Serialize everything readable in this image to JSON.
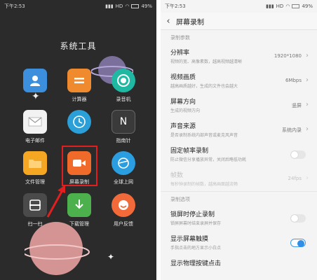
{
  "left": {
    "status": {
      "time": "下午2:53",
      "hd": "HD",
      "battery": "49%"
    },
    "folder_title": "系统工具",
    "apps": [
      {
        "label": "",
        "icon": "contacts-icon",
        "color": "#3b8fdc"
      },
      {
        "label": "计算器",
        "icon": "calculator-icon",
        "color": "#f08a2f"
      },
      {
        "label": "录音机",
        "icon": "recorder-icon",
        "color": "#1fb8a2"
      },
      {
        "label": "电子邮件",
        "icon": "mail-icon",
        "color": "#f2f2f2"
      },
      {
        "label": "",
        "icon": "clock-icon",
        "color": "#2b9fd8"
      },
      {
        "label": "指南针",
        "icon": "compass-icon",
        "color": "#3a3a3a"
      },
      {
        "label": "文件管理",
        "icon": "folder-icon",
        "color": "#f5a623"
      },
      {
        "label": "屏幕录制",
        "icon": "screen-record-icon",
        "color": "#f06a2a"
      },
      {
        "label": "全球上网",
        "icon": "globe-plane-icon",
        "color": "#2a9ee0"
      },
      {
        "label": "扫一扫",
        "icon": "scan-icon",
        "color": "#4a4a4a"
      },
      {
        "label": "下载管理",
        "icon": "download-icon",
        "color": "#4cb04c"
      },
      {
        "label": "用户反馈",
        "icon": "feedback-icon",
        "color": "#f26a3a"
      }
    ]
  },
  "right": {
    "status": {
      "time": "下午2:53",
      "hd": "HD",
      "battery": "49%"
    },
    "title": "屏幕录制",
    "section_params": "录制参数",
    "resolution": {
      "title": "分辨率",
      "desc": "视频的宽、高像素数，越高视频越清晰",
      "value": "1920*1080"
    },
    "quality": {
      "title": "视频画质",
      "desc": "越高画质越好，生成的文件也会越大",
      "value": "6Mbps"
    },
    "orientation": {
      "title": "屏幕方向",
      "desc": "生成的视频方向",
      "value": "竖屏"
    },
    "sound": {
      "title": "声音来源",
      "desc": "是否录制系统内部声音或麦克风声音",
      "value": "系统内录"
    },
    "fixed_fps": {
      "title": "固定帧率录制",
      "desc": "防止微信分享播放异常，关闭后略低功耗",
      "on": false
    },
    "fps": {
      "title": "帧数",
      "desc": "每秒钟录制的帧数，越高画面越流畅",
      "value": "24fps"
    },
    "section_options": "录制选项",
    "lock_stop": {
      "title": "锁屏时停止录制",
      "desc": "锁屏屏幕时结束录屏并保存",
      "on": false
    },
    "show_touch": {
      "title": "显示屏幕触摸",
      "desc": "手指点击的地方显示小白点",
      "on": true
    },
    "show_keys": {
      "title": "显示物理按键点击"
    }
  }
}
